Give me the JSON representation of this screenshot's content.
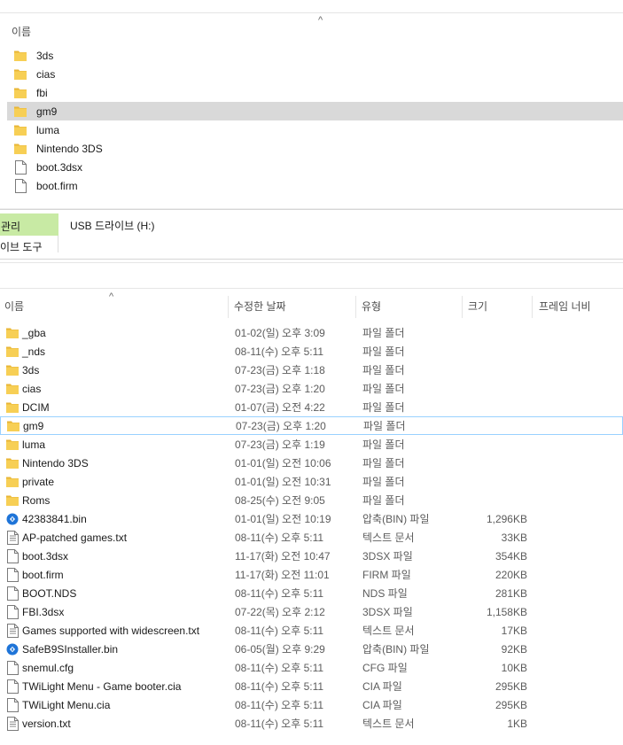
{
  "top_window": {
    "column_name": "이름",
    "sort_glyph": "^",
    "items": [
      {
        "name": "3ds",
        "kind": "folder",
        "icon": "folder-icon"
      },
      {
        "name": "cias",
        "kind": "folder",
        "icon": "folder-icon"
      },
      {
        "name": "fbi",
        "kind": "folder",
        "icon": "folder-icon"
      },
      {
        "name": "gm9",
        "kind": "folder",
        "icon": "folder-icon",
        "selected": true
      },
      {
        "name": "luma",
        "kind": "folder",
        "icon": "folder-icon"
      },
      {
        "name": "Nintendo 3DS",
        "kind": "folder",
        "icon": "folder-icon"
      },
      {
        "name": "boot.3dsx",
        "kind": "file",
        "icon": "document-icon"
      },
      {
        "name": "boot.firm",
        "kind": "file",
        "icon": "document-icon"
      }
    ]
  },
  "ribbon": {
    "manage_tab": "관리",
    "drive_tools_tab": "이브 도구",
    "drive_title": "USB 드라이브 (H:)",
    "accent_color": "#c8eaa4"
  },
  "list": {
    "sort_glyph": "^",
    "columns": {
      "name": "이름",
      "date": "수정한 날짜",
      "type": "유형",
      "size": "크기",
      "frame": "프레임 너비"
    },
    "rows": [
      {
        "name": "_gba",
        "date": "01-02(일) 오후 3:09",
        "type": "파일 폴더",
        "size": "",
        "icon": "folder-icon"
      },
      {
        "name": "_nds",
        "date": "08-11(수) 오후 5:11",
        "type": "파일 폴더",
        "size": "",
        "icon": "folder-icon"
      },
      {
        "name": "3ds",
        "date": "07-23(금) 오후 1:18",
        "type": "파일 폴더",
        "size": "",
        "icon": "folder-icon"
      },
      {
        "name": "cias",
        "date": "07-23(금) 오후 1:20",
        "type": "파일 폴더",
        "size": "",
        "icon": "folder-icon"
      },
      {
        "name": "DCIM",
        "date": "01-07(금) 오전 4:22",
        "type": "파일 폴더",
        "size": "",
        "icon": "folder-icon"
      },
      {
        "name": "gm9",
        "date": "07-23(금) 오후 1:20",
        "type": "파일 폴더",
        "size": "",
        "icon": "folder-icon",
        "focused": true
      },
      {
        "name": "luma",
        "date": "07-23(금) 오후 1:19",
        "type": "파일 폴더",
        "size": "",
        "icon": "folder-icon"
      },
      {
        "name": "Nintendo 3DS",
        "date": "01-01(일) 오전 10:06",
        "type": "파일 폴더",
        "size": "",
        "icon": "folder-icon"
      },
      {
        "name": "private",
        "date": "01-01(일) 오전 10:31",
        "type": "파일 폴더",
        "size": "",
        "icon": "folder-icon"
      },
      {
        "name": "Roms",
        "date": "08-25(수) 오전 9:05",
        "type": "파일 폴더",
        "size": "",
        "icon": "folder-icon"
      },
      {
        "name": "42383841.bin",
        "date": "01-01(일) 오전 10:19",
        "type": "압축(BIN) 파일",
        "size": "1,296KB",
        "icon": "bin-archive-icon"
      },
      {
        "name": "AP-patched games.txt",
        "date": "08-11(수) 오후 5:11",
        "type": "텍스트 문서",
        "size": "33KB",
        "icon": "text-document-icon"
      },
      {
        "name": "boot.3dsx",
        "date": "11-17(화) 오전 10:47",
        "type": "3DSX 파일",
        "size": "354KB",
        "icon": "document-icon"
      },
      {
        "name": "boot.firm",
        "date": "11-17(화) 오전 11:01",
        "type": "FIRM 파일",
        "size": "220KB",
        "icon": "document-icon"
      },
      {
        "name": "BOOT.NDS",
        "date": "08-11(수) 오후 5:11",
        "type": "NDS 파일",
        "size": "281KB",
        "icon": "document-icon"
      },
      {
        "name": "FBI.3dsx",
        "date": "07-22(목) 오후 2:12",
        "type": "3DSX 파일",
        "size": "1,158KB",
        "icon": "document-icon"
      },
      {
        "name": "Games supported with widescreen.txt",
        "date": "08-11(수) 오후 5:11",
        "type": "텍스트 문서",
        "size": "17KB",
        "icon": "text-document-icon"
      },
      {
        "name": "SafeB9SInstaller.bin",
        "date": "06-05(월) 오후 9:29",
        "type": "압축(BIN) 파일",
        "size": "92KB",
        "icon": "bin-archive-icon"
      },
      {
        "name": "snemul.cfg",
        "date": "08-11(수) 오후 5:11",
        "type": "CFG 파일",
        "size": "10KB",
        "icon": "document-icon"
      },
      {
        "name": "TWiLight Menu - Game booter.cia",
        "date": "08-11(수) 오후 5:11",
        "type": "CIA 파일",
        "size": "295KB",
        "icon": "document-icon"
      },
      {
        "name": "TWiLight Menu.cia",
        "date": "08-11(수) 오후 5:11",
        "type": "CIA 파일",
        "size": "295KB",
        "icon": "document-icon"
      },
      {
        "name": "version.txt",
        "date": "08-11(수) 오후 5:11",
        "type": "텍스트 문서",
        "size": "1KB",
        "icon": "text-document-icon"
      }
    ]
  },
  "colors": {
    "folder": "#f7cf55",
    "folder_dark": "#e8b636",
    "selection": "#d9d9d9",
    "focus_border": "#99d1ff",
    "bin_icon": "#1e74d8"
  }
}
